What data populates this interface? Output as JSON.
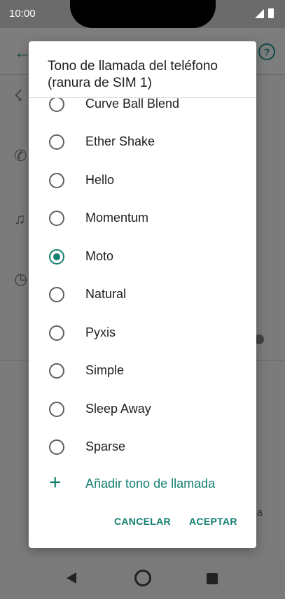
{
  "status_bar": {
    "time": "10:00"
  },
  "background_app": {
    "fragment_text": "a"
  },
  "dialog": {
    "title": "Tono de llamada del teléfono (ranura de SIM 1)",
    "options": [
      {
        "label": "Curve Ball Blend",
        "selected": false
      },
      {
        "label": "Ether Shake",
        "selected": false
      },
      {
        "label": "Hello",
        "selected": false
      },
      {
        "label": "Momentum",
        "selected": false
      },
      {
        "label": "Moto",
        "selected": true
      },
      {
        "label": "Natural",
        "selected": false
      },
      {
        "label": "Pyxis",
        "selected": false
      },
      {
        "label": "Simple",
        "selected": false
      },
      {
        "label": "Sleep Away",
        "selected": false
      },
      {
        "label": "Sparse",
        "selected": false
      }
    ],
    "add_ringtone_label": "Añadir tono de llamada",
    "cancel_label": "CANCELAR",
    "accept_label": "ACEPTAR"
  },
  "colors": {
    "accent": "#137f70",
    "scrim": "#7a7a7a"
  }
}
